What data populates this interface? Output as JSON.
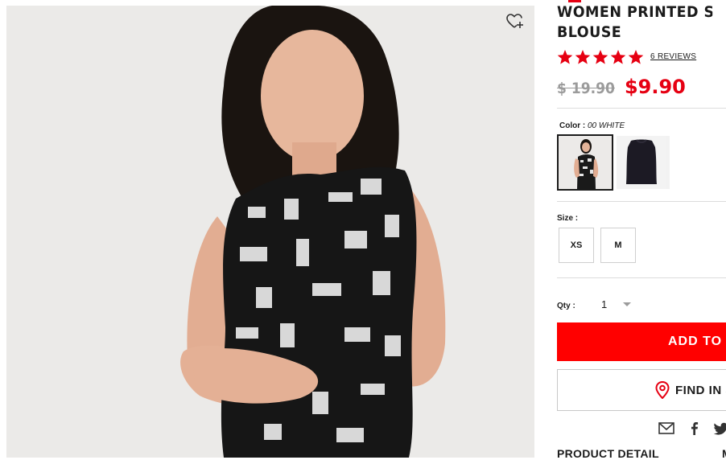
{
  "product": {
    "title_line1": "WOMEN PRINTED SLE",
    "title_line2": "BLOUSE",
    "rating_stars": 5,
    "reviews": "6 REVIEWS",
    "price_old": "$ 19.90",
    "price_new": "$9.90"
  },
  "color": {
    "label": "Color :",
    "value": "00 WHITE",
    "swatches": [
      "model-print-white",
      "black-blouse"
    ]
  },
  "size": {
    "label": "Size :",
    "options": [
      "XS",
      "M"
    ]
  },
  "quantity": {
    "label": "Qty :",
    "value": "1"
  },
  "actions": {
    "add_to_bag": "ADD TO B",
    "find_in_store": "FIND IN S"
  },
  "share_icons": [
    "mail-icon",
    "facebook-icon",
    "twitter-icon"
  ],
  "tabs": {
    "product_detail": "PRODUCT DETAIL",
    "more": "M"
  },
  "colors": {
    "accent_red": "#ff0000",
    "sale_red": "#e60012",
    "text": "#1b1b1b",
    "muted": "#9b9b9b"
  }
}
